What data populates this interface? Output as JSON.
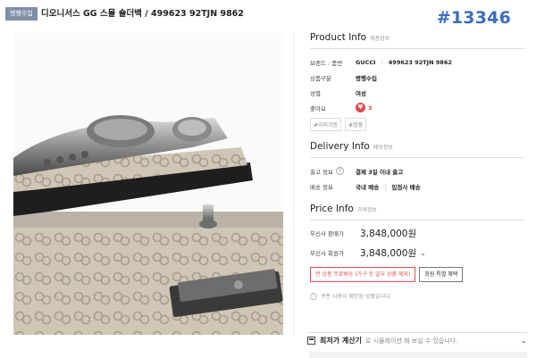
{
  "header": {
    "badge": "병행수입",
    "title": "디오니서스 GG 스몰 숄더백 / 499623 92TJN 9862",
    "id_tag": "#13346"
  },
  "product_info": {
    "title": "Product Info",
    "subtitle": "제품정보",
    "rows": [
      {
        "key": "브랜드 : 품번",
        "value": "GUCCI",
        "value2": "499623 92TJN 9862"
      },
      {
        "key": "상품구분",
        "value": "병행수입"
      },
      {
        "key": "성별",
        "value": "여성"
      },
      {
        "key": "좋아요",
        "value": "3"
      }
    ],
    "tags": [
      "#이지가방",
      "#명품"
    ]
  },
  "delivery_info": {
    "title": "Delivery Info",
    "subtitle": "배송정보",
    "rows": [
      {
        "key": "출고 정보",
        "value": "결제 3일 이내 출고"
      },
      {
        "key": "배송 정보",
        "value": "국내 배송",
        "value2": "입점사 배송"
      }
    ]
  },
  "price_info": {
    "title": "Price Info",
    "subtitle": "가격정보",
    "sale_label": "무신사 판매가",
    "sale_price": "3,848,000원",
    "member_label": "무신사 회원가",
    "member_price": "3,848,000원",
    "free_shipping_button": "전 상품 무료배송 (가구 등 일부 상품 제외)",
    "member_benefit_button": "회원 특별 혜택",
    "coupon_notice": "쿠폰 사용이 제한된 상품입니다."
  },
  "calculator": {
    "title": "최저가 계산기",
    "subtitle": "로 시뮬레이션 해 보실 수 있습니다."
  },
  "colors": {
    "accent_blue": "#3b6cc4",
    "like_red": "#e24b4b",
    "badge_gray": "#7f8fa6"
  }
}
